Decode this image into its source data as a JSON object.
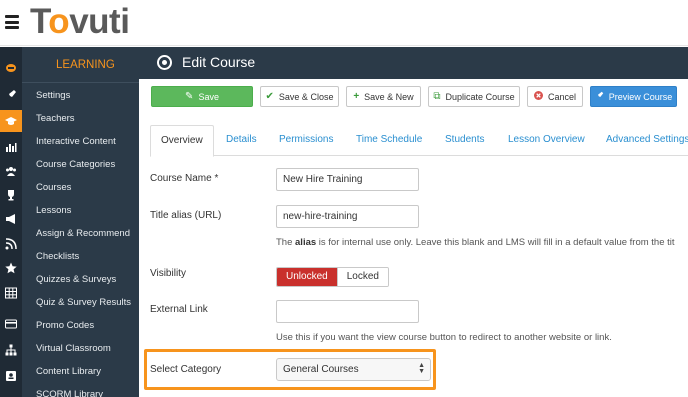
{
  "app": {
    "logo_text_prefix": "T",
    "logo_text_o": "o",
    "logo_text_suffix": "vuti",
    "brand_color": "#f7941d"
  },
  "topbar": {
    "menu_icon": "hamburger-icon"
  },
  "rail": {
    "icons": [
      "home-icon",
      "rocket-icon",
      "graduation-cap-icon",
      "bar-chart-icon",
      "users-icon",
      "trophy-icon",
      "megaphone-icon",
      "feed-icon",
      "star-icon",
      "table-icon",
      "credit-card-icon",
      "sitemap-icon",
      "contact-card-icon"
    ],
    "active_index": 2
  },
  "sidebar": {
    "header": "LEARNING",
    "items": [
      {
        "label": "Settings"
      },
      {
        "label": "Teachers"
      },
      {
        "label": "Interactive Content"
      },
      {
        "label": "Course Categories"
      },
      {
        "label": "Courses"
      },
      {
        "label": "Lessons"
      },
      {
        "label": "Assign & Recommend"
      },
      {
        "label": "Checklists"
      },
      {
        "label": "Quizzes & Surveys"
      },
      {
        "label": "Quiz & Survey Results"
      },
      {
        "label": "Promo Codes"
      },
      {
        "label": "Virtual Classroom"
      },
      {
        "label": "Content Library"
      },
      {
        "label": "SCORM Library"
      }
    ]
  },
  "header": {
    "title": "Edit Course"
  },
  "toolbar": {
    "save": "Save",
    "save_close": "Save & Close",
    "save_new": "Save & New",
    "duplicate": "Duplicate Course",
    "cancel": "Cancel",
    "preview": "Preview Course"
  },
  "tabs": [
    {
      "label": "Overview",
      "active": true
    },
    {
      "label": "Details"
    },
    {
      "label": "Permissions"
    },
    {
      "label": "Time Schedule"
    },
    {
      "label": "Students"
    },
    {
      "label": "Lesson Overview"
    },
    {
      "label": "Advanced Settings"
    }
  ],
  "form": {
    "course_name": {
      "label": "Course Name *",
      "value": "New Hire Training"
    },
    "title_alias": {
      "label": "Title alias (URL)",
      "value": "new-hire-training",
      "help_prefix": "The ",
      "help_bold": "alias",
      "help_suffix": " is for internal use only. Leave this blank and LMS will fill in a default value from the tit"
    },
    "visibility": {
      "label": "Visibility",
      "options": [
        "Unlocked",
        "Locked"
      ],
      "selected": "Unlocked"
    },
    "external_link": {
      "label": "External Link",
      "value": "",
      "help": "Use this if you want the view course button to redirect to another website or link."
    },
    "category": {
      "label": "Select Category",
      "selected": "General Courses"
    }
  }
}
